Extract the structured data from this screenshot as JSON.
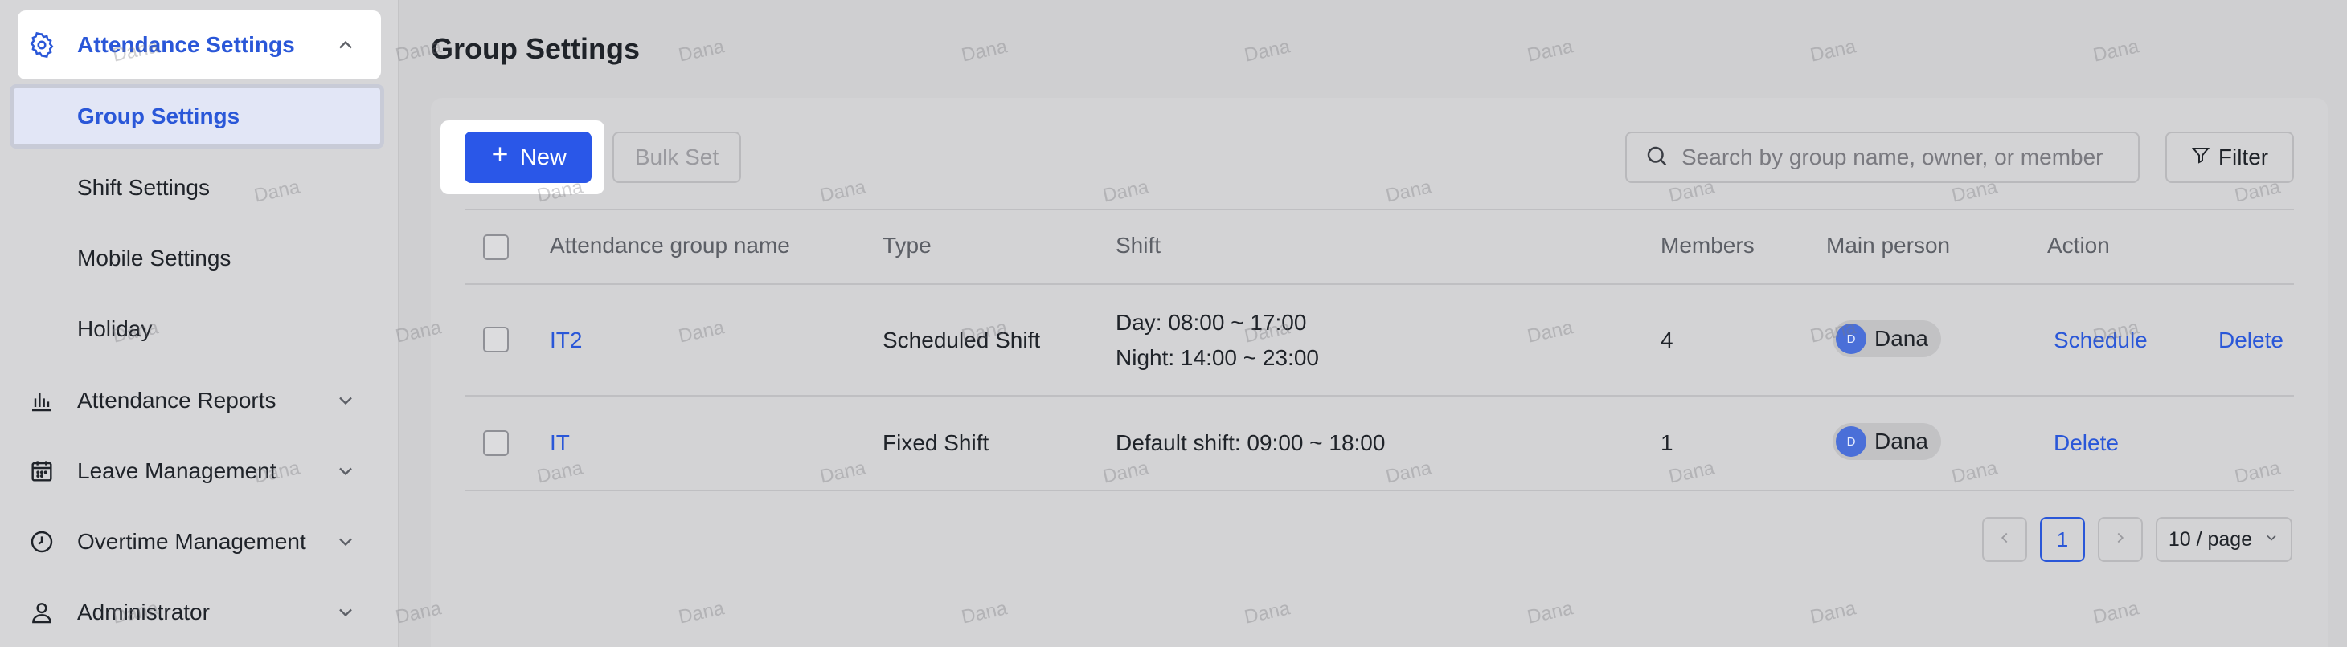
{
  "sidebar": {
    "items": [
      {
        "label": "Attendance Settings",
        "icon": "gear-icon",
        "expanded": true
      },
      {
        "label": "Group Settings",
        "selected": true
      },
      {
        "label": "Shift Settings"
      },
      {
        "label": "Mobile Settings"
      },
      {
        "label": "Holiday"
      },
      {
        "label": "Attendance Reports",
        "icon": "bar-chart-icon"
      },
      {
        "label": "Leave Management",
        "icon": "calendar-icon"
      },
      {
        "label": "Overtime Management",
        "icon": "clock-icon"
      },
      {
        "label": "Administrator",
        "icon": "user-icon"
      }
    ]
  },
  "main": {
    "title": "Group Settings",
    "toolbar": {
      "new_label": "New",
      "bulk_set_label": "Bulk Set",
      "search_placeholder": "Search by group name, owner, or member",
      "filter_label": "Filter"
    },
    "table": {
      "columns": [
        "Attendance group name",
        "Type",
        "Shift",
        "Members",
        "Main person",
        "Action"
      ],
      "rows": [
        {
          "name": "IT2",
          "type": "Scheduled Shift",
          "shift_lines": [
            "Day: 08:00 ~ 17:00",
            "Night: 14:00 ~ 23:00"
          ],
          "members": "4",
          "owner_initial": "D",
          "owner_name": "Dana",
          "actions": [
            "Schedule",
            "Delete"
          ]
        },
        {
          "name": "IT",
          "type": "Fixed Shift",
          "shift_lines": [
            "Default shift: 09:00 ~ 18:00"
          ],
          "members": "1",
          "owner_initial": "D",
          "owner_name": "Dana",
          "actions": [
            "Delete"
          ]
        }
      ]
    },
    "pagination": {
      "current_page": "1",
      "page_size": "10 / page"
    }
  },
  "watermark": "Dana",
  "colors": {
    "accent": "#2a57e8",
    "link": "#2a57d8",
    "avatar": "#4a6fd8"
  }
}
